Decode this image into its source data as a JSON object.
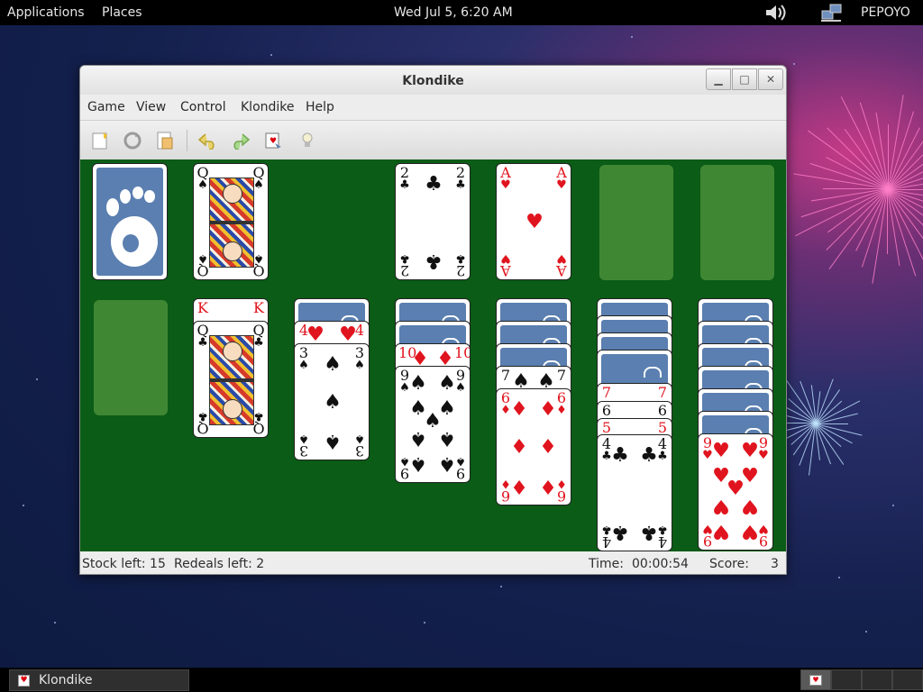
{
  "top_panel": {
    "applications": "Applications",
    "places": "Places",
    "clock": "Wed Jul  5,  6:20 AM",
    "user": "PEPOYO"
  },
  "window": {
    "title": "Klondike",
    "menu": [
      "Game",
      "View",
      "Control",
      "Klondike",
      "Help"
    ],
    "toolbar_icons": [
      "new-game-icon",
      "restart-icon",
      "select-game-icon",
      "undo-icon",
      "redo-icon",
      "deal-icon",
      "hint-icon"
    ],
    "status": {
      "stock_left": "Stock left: 15",
      "redeals_left": "Redeals left: 2",
      "time_label": "Time:",
      "time_value": "00:00:54",
      "score_label": "Score:",
      "score_value": "3"
    }
  },
  "cards": {
    "waste": {
      "rank": "Q",
      "suit": "♠"
    },
    "foundation_1": {
      "rank": "2",
      "suit": "♣"
    },
    "foundation_2": {
      "rank": "A",
      "suit": "♥"
    },
    "t2_king": {
      "rank": "K",
      "suit": "♥"
    },
    "t2_queen": {
      "rank": "Q",
      "suit": "♣"
    },
    "t3_four": {
      "rank": "4",
      "suit": "♥"
    },
    "t3_three": {
      "rank": "3",
      "suit": "♠"
    },
    "t4_ten": {
      "rank": "10",
      "suit": "♦"
    },
    "t4_nine": {
      "rank": "9",
      "suit": "♠"
    },
    "t5_seven": {
      "rank": "7",
      "suit": "♠"
    },
    "t5_six": {
      "rank": "6",
      "suit": "♦"
    },
    "t6_seven": {
      "rank": "7",
      "suit": "♥"
    },
    "t6_six": {
      "rank": "6",
      "suit": "♠"
    },
    "t6_five": {
      "rank": "5",
      "suit": "♥"
    },
    "t6_four": {
      "rank": "4",
      "suit": "♣"
    },
    "t7_nine": {
      "rank": "9",
      "suit": "♥"
    }
  },
  "taskbar": {
    "task_label": "Klondike"
  }
}
